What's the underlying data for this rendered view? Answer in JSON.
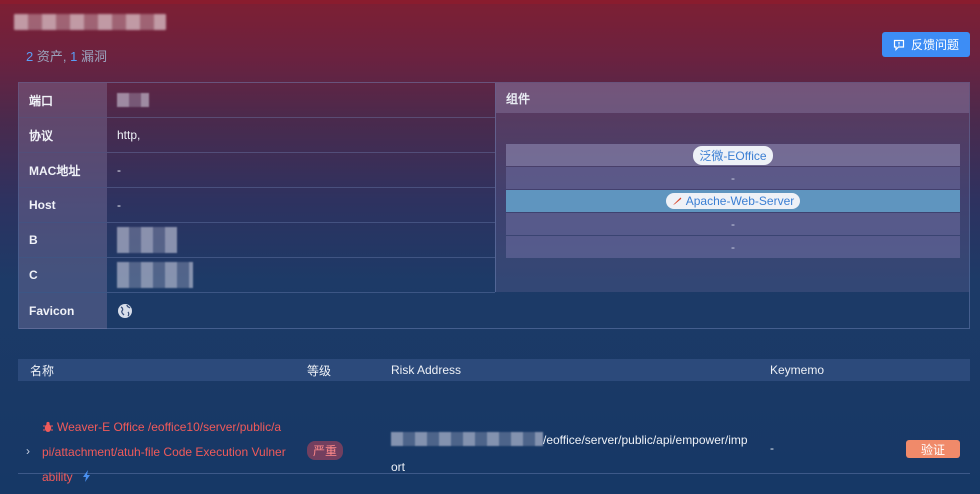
{
  "header": {
    "summary_assets_count": "2",
    "summary_assets_label": "资产,",
    "summary_vulns_count": "1",
    "summary_vulns_label": "漏洞",
    "feedback_label": "反馈问题"
  },
  "info": {
    "rows": [
      {
        "key": "端口",
        "value": ""
      },
      {
        "key": "协议",
        "value": "http,"
      },
      {
        "key": "MAC地址",
        "value": "-"
      },
      {
        "key": "Host",
        "value": "-"
      },
      {
        "key": "B",
        "value": ""
      },
      {
        "key": "C",
        "value": ""
      }
    ],
    "favicon_label": "Favicon",
    "favicon_icon": "globe-icon"
  },
  "components": {
    "header": "组件",
    "items": [
      {
        "label": "泛微-EOffice",
        "chip": true,
        "icon": ""
      },
      {
        "label": "-",
        "chip": false,
        "icon": ""
      },
      {
        "label": "Apache-Web-Server",
        "chip": true,
        "icon": "feather-icon"
      },
      {
        "label": "-",
        "chip": false,
        "icon": ""
      },
      {
        "label": "-",
        "chip": false,
        "icon": ""
      }
    ]
  },
  "vulns": {
    "columns": {
      "name": "名称",
      "level": "等级",
      "address": "Risk Address",
      "memo": "Keymemo"
    },
    "rows": [
      {
        "name_line1": "Weaver-E Office /eoffice10/server/public/a",
        "name_line2": "pi/attachment/atuh-file Code Execution Vulner",
        "name_line3": "ability",
        "severity": "严重",
        "address_line1": "/eoffice/server/public/api/empower/imp",
        "address_line2": "ort",
        "memo": "-",
        "action": "验证"
      }
    ]
  },
  "colors": {
    "accent": "#3d8df5",
    "danger": "#f05a5a",
    "verify": "#f08a6a"
  }
}
